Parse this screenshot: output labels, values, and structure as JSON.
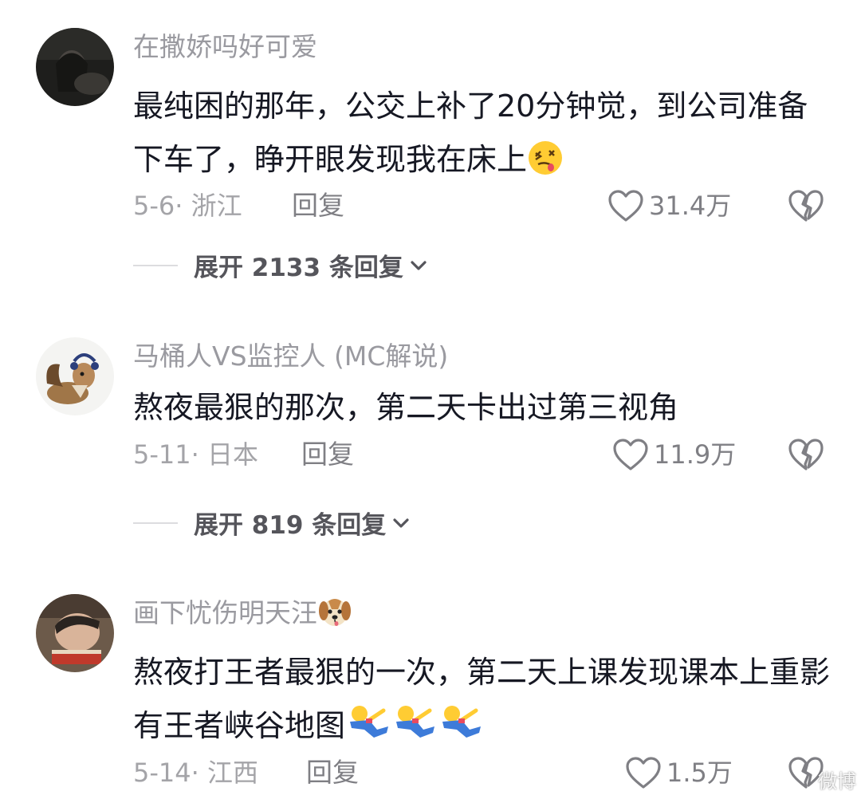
{
  "comments": [
    {
      "username": "在撒娇吗好可爱",
      "text": "最纯困的那年，公交上补了20分钟觉，到公司准备下车了，睁开眼发现我在床上",
      "text_emojis": [
        "woozy-face"
      ],
      "date_location": "5-6· 浙江",
      "reply_label": "回复",
      "likes": "31.4万",
      "expand_label": "展开 2133 条回复"
    },
    {
      "username": "马桶人VS监控人 (MC解说)",
      "text": "熬夜最狠的那次，第二天卡出过第三视角",
      "text_emojis": [],
      "date_location": "5-11· 日本",
      "reply_label": "回复",
      "likes": "11.9万",
      "expand_label": "展开 819 条回复"
    },
    {
      "username": "画下忧伤明天汪",
      "username_emoji": "dog-face",
      "text": "熬夜打王者最狠的一次，第二天上课发现课本上重影有王者峡谷地图",
      "text_emojis": [
        "falling-person",
        "falling-person",
        "falling-person"
      ],
      "date_location": "5-14· 江西",
      "reply_label": "回复",
      "likes": "1.5万"
    }
  ],
  "watermark": "微博",
  "icons": {
    "like": "heart-outline-icon",
    "dislike": "broken-heart-icon",
    "expand": "chevron-down-icon"
  },
  "colors": {
    "username": "#9a9aa0",
    "body": "#161823",
    "meta": "#a4a4a8",
    "action": "#7f7f84"
  }
}
